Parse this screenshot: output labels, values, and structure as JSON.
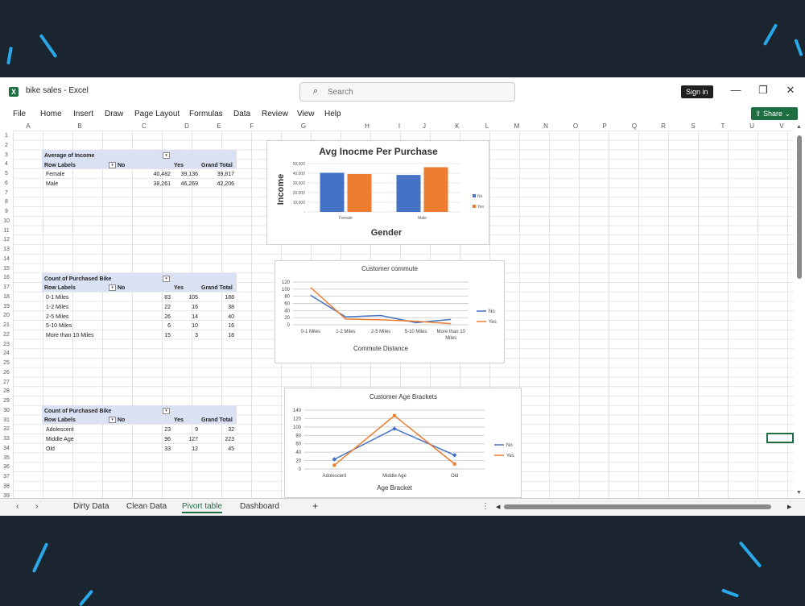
{
  "window": {
    "app_title": "bike sales  -  Excel",
    "search_placeholder": "Search",
    "sign_in": "Sign in",
    "minimize": "—",
    "restore": "❐",
    "close": "✕"
  },
  "menu": [
    "File",
    "Home",
    "Insert",
    "Draw",
    "Page Layout",
    "Formulas",
    "Data",
    "Review",
    "View",
    "Help"
  ],
  "share_label": "Share  ⌄",
  "columns": [
    "A",
    "B",
    "C",
    "D",
    "E",
    "F",
    "G",
    "H",
    "I",
    "J",
    "K",
    "L",
    "M",
    "N",
    "O",
    "P",
    "Q",
    "R",
    "S",
    "T",
    "U",
    "V"
  ],
  "rows": [
    "1",
    "2",
    "3",
    "4",
    "5",
    "6",
    "7",
    "8",
    "9",
    "10",
    "11",
    "12",
    "13",
    "14",
    "15",
    "16",
    "17",
    "18",
    "19",
    "20",
    "21",
    "22",
    "23",
    "24",
    "25",
    "26",
    "27",
    "28",
    "29",
    "30",
    "31",
    "32",
    "33",
    "34",
    "35",
    "36",
    "37",
    "38",
    "39"
  ],
  "pivot1": {
    "title": "Average of Income",
    "row_labels": "Row Labels",
    "no": "No",
    "yes": "Yes",
    "grand_total": "Grand Total",
    "rows": [
      {
        "label": "Female",
        "no": "40,482",
        "yes": "39,136",
        "total": "39,817"
      },
      {
        "label": "Male",
        "no": "38,261",
        "yes": "46,269",
        "total": "42,206"
      }
    ]
  },
  "pivot2": {
    "title": "Count of Purchased Bike",
    "row_labels": "Row Labels",
    "no": "No",
    "yes": "Yes",
    "grand_total": "Grand Total",
    "rows": [
      {
        "label": "0-1 Miles",
        "no": "83",
        "yes": "105",
        "total": "188"
      },
      {
        "label": "1-2 Miles",
        "no": "22",
        "yes": "16",
        "total": "38"
      },
      {
        "label": "2-5 Miles",
        "no": "26",
        "yes": "14",
        "total": "40"
      },
      {
        "label": "5-10 Miles",
        "no": "6",
        "yes": "10",
        "total": "16"
      },
      {
        "label": "More than 10 Miles",
        "no": "15",
        "yes": "3",
        "total": "18"
      }
    ]
  },
  "pivot3": {
    "title": "Count of Purchased Bike",
    "row_labels": "Row Labels",
    "no": "No",
    "yes": "Yes",
    "grand_total": "Grand Total",
    "rows": [
      {
        "label": "Adolescent",
        "no": "23",
        "yes": "9",
        "total": "32"
      },
      {
        "label": "Middle Age",
        "no": "96",
        "yes": "127",
        "total": "223"
      },
      {
        "label": "Old",
        "no": "33",
        "yes": "12",
        "total": "45"
      }
    ]
  },
  "chart_data": [
    {
      "type": "bar",
      "title": "Avg Inocme Per Purchase",
      "xlabel": "Gender",
      "ylabel": "Income",
      "categories": [
        "Female",
        "Male"
      ],
      "series": [
        {
          "name": "No",
          "values": [
            40482,
            38261
          ]
        },
        {
          "name": "Yes",
          "values": [
            39136,
            46269
          ]
        }
      ],
      "ylim": [
        0,
        50000
      ],
      "yticks": [
        "-",
        "10,000",
        "20,000",
        "30,000",
        "40,000",
        "50,000"
      ],
      "legend": "right",
      "grid": true,
      "colors": [
        "#4472c4",
        "#ed7d31"
      ]
    },
    {
      "type": "line",
      "title": "Customer commute",
      "xlabel": "Commute Distance",
      "ylabel": "",
      "categories": [
        "0-1 Miles",
        "1-2 Miles",
        "2-5 Miles",
        "5-10 Miles",
        "More than 10 Miles"
      ],
      "series": [
        {
          "name": "No",
          "values": [
            83,
            22,
            26,
            6,
            15
          ]
        },
        {
          "name": "Yes",
          "values": [
            105,
            16,
            14,
            10,
            3
          ]
        }
      ],
      "ylim": [
        0,
        120
      ],
      "yticks": [
        "0",
        "20",
        "40",
        "60",
        "80",
        "100",
        "120"
      ],
      "legend": "right",
      "grid": true,
      "colors": [
        "#4472c4",
        "#ed7d31"
      ]
    },
    {
      "type": "line",
      "title": "Customer Age Brackets",
      "xlabel": "Age Bracket",
      "ylabel": "",
      "categories": [
        "Adolescent",
        "Middle Age",
        "Old"
      ],
      "series": [
        {
          "name": "No",
          "values": [
            23,
            96,
            33
          ]
        },
        {
          "name": "Yes",
          "values": [
            9,
            127,
            12
          ]
        }
      ],
      "ylim": [
        0,
        140
      ],
      "yticks": [
        "0",
        "20",
        "40",
        "60",
        "80",
        "100",
        "120",
        "140"
      ],
      "legend": "right",
      "grid": true,
      "colors": [
        "#4472c4",
        "#ed7d31"
      ]
    }
  ],
  "tabs": [
    "Dirty Data",
    "Clean Data",
    "Pivort table",
    "Dashboard"
  ],
  "tab_nav": {
    "prev": "‹",
    "next": "›",
    "add": "+",
    "more": "⋮"
  },
  "icons": {
    "search": "⌕",
    "scroll_up": "▲",
    "scroll_down": "▼",
    "scroll_left": "◀",
    "scroll_right": "▶",
    "share": "share-icon"
  }
}
